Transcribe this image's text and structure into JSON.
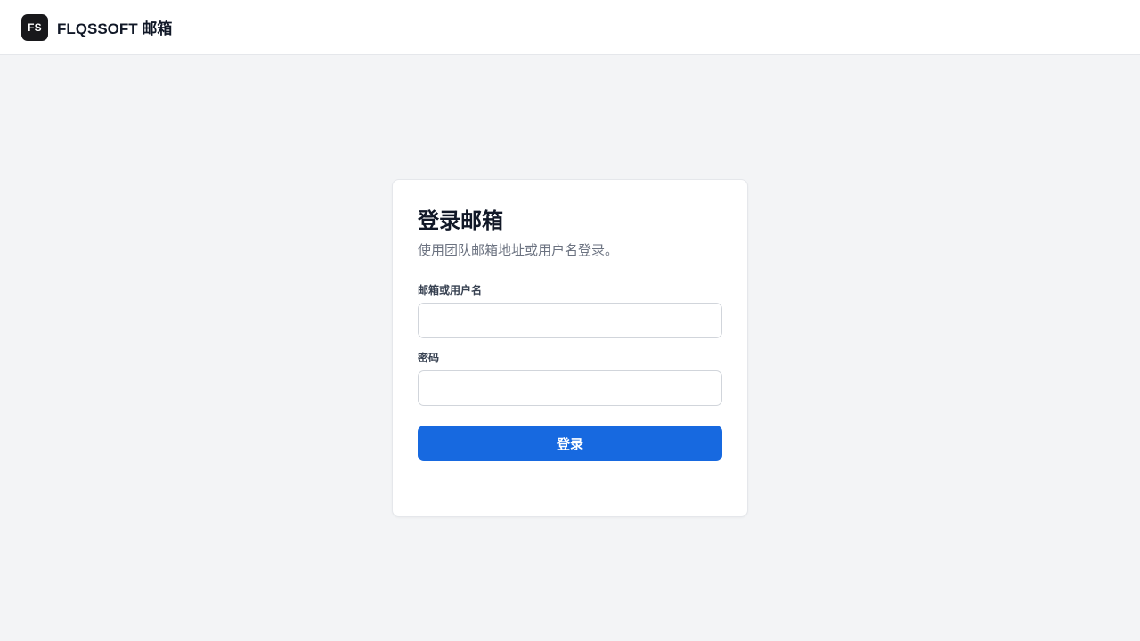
{
  "header": {
    "logo_text": "FS",
    "brand": "FLQSSOFT 邮箱"
  },
  "login": {
    "title": "登录邮箱",
    "subtitle": "使用团队邮箱地址或用户名登录。",
    "username_label": "邮箱或用户名",
    "username_value": "",
    "password_label": "密码",
    "password_value": "",
    "submit_label": "登录"
  },
  "colors": {
    "primary": "#1769e0",
    "background": "#f3f4f6",
    "logo_bg": "#18181b"
  }
}
